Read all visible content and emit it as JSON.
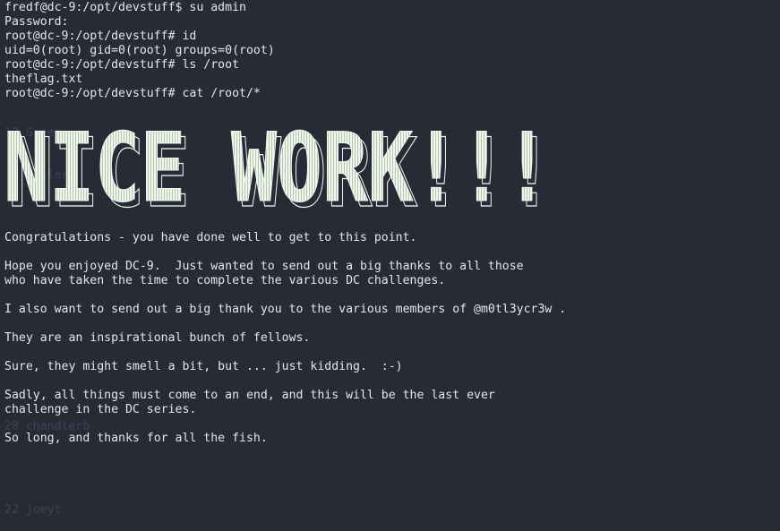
{
  "terminal": {
    "top_lines": [
      "fredf@dc-9:/opt/devstuff$ su admin",
      "Password:",
      "root@dc-9:/opt/devstuff# id",
      "uid=0(root) gid=0(root) groups=0(root)",
      "root@dc-9:/opt/devstuff# ls /root",
      "theflag.txt",
      "root@dc-9:/opt/devstuff# cat /root/*"
    ],
    "background_ghost_lines": [
      "13 Green",
      "14 Geller",
      "",
      "",
      "",
      "",
      "",
      "20 chandlerb",
      "",
      "22 joeyt"
    ],
    "banner_text": "NICE WORK!!!",
    "message": {
      "congrats": "Congratulations - you have done well to get to this point.",
      "hope_1": "Hope you enjoyed DC-9.  Just wanted to send out a big thanks to all those",
      "hope_2": "who have taken the time to complete the various DC challenges.",
      "thanks": "I also want to send out a big thank you to the various members of @m0tl3ycr3w .",
      "inspirational": "They are an inspirational bunch of fellows.",
      "smell": "Sure, they might smell a bit, but ... just kidding.  :-)",
      "sadly_1": "Sadly, all things must come to an end, and this will be the last ever",
      "sadly_2": "challenge in the DC series.",
      "fish": "So long, and thanks for all the fish."
    }
  },
  "colors": {
    "background": "#282a36",
    "text": "#e6e6e6",
    "banner_fill": "#f2f4f0",
    "banner_grid": "#9ec09a",
    "ghost": "#3e4250"
  }
}
